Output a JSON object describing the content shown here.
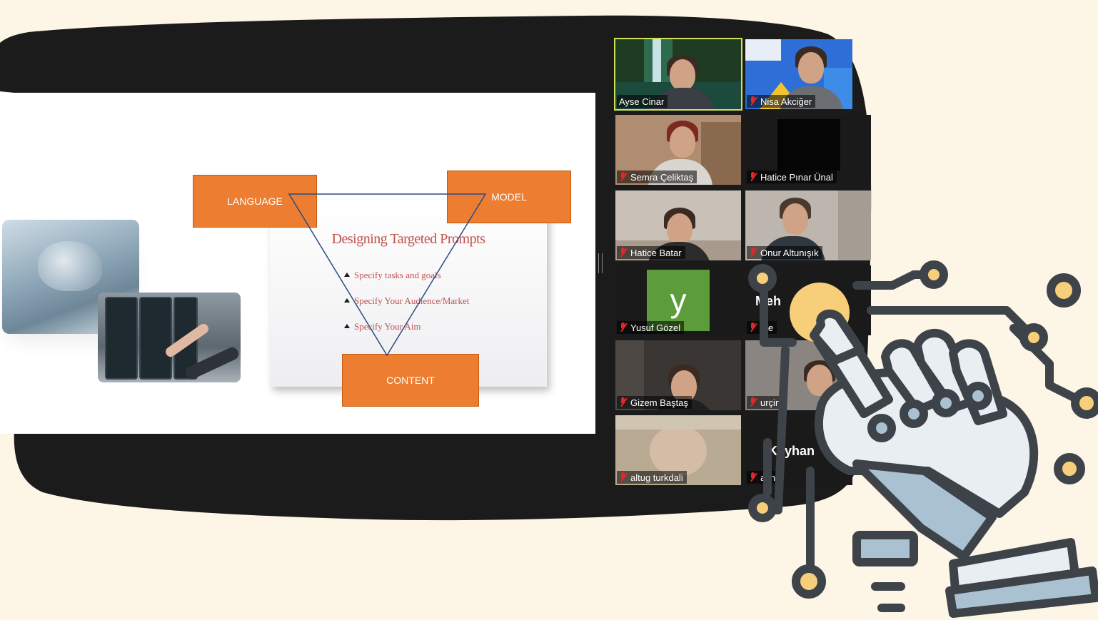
{
  "slide": {
    "title": "Designing Targeted Prompts",
    "bullets": [
      "Specify tasks and goals",
      "Specify Your Audience/Market",
      "Specify Your Aim"
    ],
    "boxes": {
      "language": "LANGUAGE",
      "model": "MODEL",
      "content": "CONTENT"
    }
  },
  "gallery": {
    "participants": [
      {
        "name": "Ayse Cinar",
        "muted": false,
        "active": true
      },
      {
        "name": "Nisa Akciğer",
        "muted": true
      },
      {
        "name": "Semra Çeliktaş",
        "muted": true
      },
      {
        "name": "Hatice Pınar Ünal",
        "muted": true
      },
      {
        "name": "Hatice Batar",
        "muted": true
      },
      {
        "name": "Onur Altunışık",
        "muted": true
      },
      {
        "name": "Yusuf Gözel",
        "muted": true,
        "avatar_letter": "y"
      },
      {
        "name": "Me",
        "muted": true,
        "display_text": "Meh"
      },
      {
        "name": "Gizem Baştaş",
        "muted": true
      },
      {
        "name": "urçin",
        "muted": true
      },
      {
        "name": "altug turkdali",
        "muted": true
      },
      {
        "name": "ayha",
        "muted": true,
        "display_text": "Kayhan"
      }
    ]
  },
  "colors": {
    "background": "#fdf5e6",
    "blob": "#1b1b1b",
    "orange_box": "#ed7d31",
    "slide_text": "#c0504d",
    "active_speaker": "#d4e157",
    "icon_stroke": "#3d4349",
    "icon_accent": "#f7cf7a",
    "icon_light": "#e8eef2",
    "icon_blue": "#a9c1d1"
  },
  "decor": {
    "robot_hand": "robot-hand-circuit-icon"
  }
}
